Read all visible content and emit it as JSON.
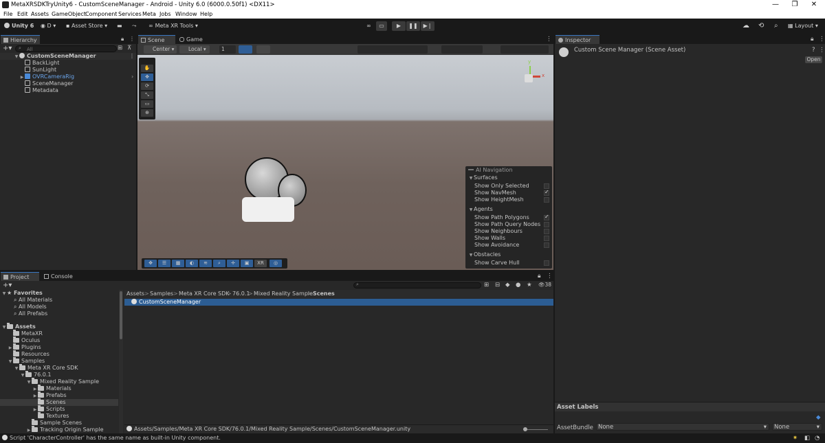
{
  "window": {
    "title": "MetaXRSDKTryUnity6 - CustomSceneManager - Android - Unity 6.0 (6000.0.50f1) <DX11>",
    "controls": [
      "—",
      "❐",
      "✕"
    ]
  },
  "menu": [
    "File",
    "Edit",
    "Assets",
    "GameObject",
    "Component",
    "Services",
    "Meta",
    "Jobs",
    "Window",
    "Help"
  ],
  "toolbar": {
    "unity_label": "Unity 6",
    "account_label": "D",
    "asset_store_label": "Asset Store",
    "meta_tools_label": "Meta XR Tools",
    "layout_label": "Layout"
  },
  "hierarchy": {
    "tab_label": "Hierarchy",
    "search_placeholder": "All",
    "scene_name": "CustomSceneManager",
    "items": [
      "BackLight",
      "SunLight",
      "OVRCameraRig",
      "SceneManager",
      "Metadata"
    ]
  },
  "scene": {
    "tabs": [
      "Scene",
      "Game"
    ],
    "pivot_label": "Center",
    "space_label": "Local",
    "snap_value": "1",
    "overlay_xr_label": "XR",
    "ai_nav": {
      "title": "AI Navigation",
      "sections": [
        {
          "name": "Surfaces",
          "options": [
            {
              "label": "Show Only Selected",
              "checked": false
            },
            {
              "label": "Show NavMesh",
              "checked": true
            },
            {
              "label": "Show HeightMesh",
              "checked": false
            }
          ]
        },
        {
          "name": "Agents",
          "options": [
            {
              "label": "Show Path Polygons",
              "checked": true
            },
            {
              "label": "Show Path Query Nodes",
              "checked": false
            },
            {
              "label": "Show Neighbours",
              "checked": false
            },
            {
              "label": "Show Walls",
              "checked": false
            },
            {
              "label": "Show Avoidance",
              "checked": false
            }
          ]
        },
        {
          "name": "Obstacles",
          "options": [
            {
              "label": "Show Carve Hull",
              "checked": false
            }
          ]
        }
      ]
    },
    "gizmo_axes": {
      "y": "y",
      "x": "x"
    }
  },
  "inspector": {
    "tab_label": "Inspector",
    "title": "Custom Scene Manager (Scene Asset)",
    "open_button": "Open",
    "asset_labels": "Asset Labels",
    "assetbundle_label": "AssetBundle",
    "assetbundle_value": "None",
    "assetbundle_variant": "None"
  },
  "project": {
    "tabs": [
      "Project",
      "Console"
    ],
    "count_badge": "38",
    "favorites_label": "Favorites",
    "favorites": [
      "All Materials",
      "All Models",
      "All Prefabs"
    ],
    "assets_label": "Assets",
    "tree": [
      {
        "label": "MetaXR",
        "depth": 1,
        "arrow": ""
      },
      {
        "label": "Oculus",
        "depth": 1,
        "arrow": ""
      },
      {
        "label": "Plugins",
        "depth": 1,
        "arrow": "▶"
      },
      {
        "label": "Resources",
        "depth": 1,
        "arrow": ""
      },
      {
        "label": "Samples",
        "depth": 1,
        "arrow": "▼"
      },
      {
        "label": "Meta XR Core SDK",
        "depth": 2,
        "arrow": "▼"
      },
      {
        "label": "76.0.1",
        "depth": 3,
        "arrow": "▼"
      },
      {
        "label": "Mixed Reality Sample",
        "depth": 4,
        "arrow": "▼"
      },
      {
        "label": "Materials",
        "depth": 5,
        "arrow": "▶"
      },
      {
        "label": "Prefabs",
        "depth": 5,
        "arrow": "▶"
      },
      {
        "label": "Scenes",
        "depth": 5,
        "arrow": "",
        "selected": true
      },
      {
        "label": "Scripts",
        "depth": 5,
        "arrow": "▶"
      },
      {
        "label": "Textures",
        "depth": 5,
        "arrow": ""
      },
      {
        "label": "Sample Scenes",
        "depth": 4,
        "arrow": ""
      },
      {
        "label": "Tracking Origin Sample",
        "depth": 4,
        "arrow": "▶"
      }
    ],
    "breadcrumb": [
      "Assets",
      "Samples",
      "Meta XR Core SDK",
      "76.0.1",
      "Mixed Reality Sample",
      "Scenes"
    ],
    "files": [
      "CustomSceneManager"
    ],
    "path": "Assets/Samples/Meta XR Core SDK/76.0.1/Mixed Reality Sample/Scenes/CustomSceneManager.unity"
  },
  "status": {
    "message": "Script 'CharacterController' has the same name as built-in Unity component."
  }
}
